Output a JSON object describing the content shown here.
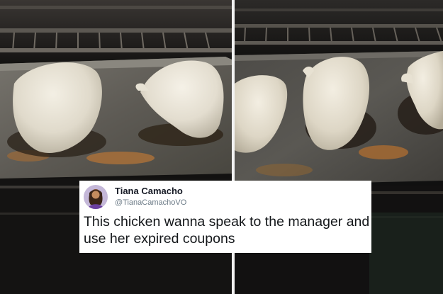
{
  "photos": {
    "left": {
      "subject": "Baked chicken breasts on a baking sheet inside an oven (first photo)"
    },
    "right": {
      "subject": "Baked chicken breasts on a baking sheet inside an oven (second photo)"
    }
  },
  "tweet": {
    "display_name": "Tiana Camacho",
    "handle": "@TianaCamachoVO",
    "text": "This chicken wanna speak to the manager and use her expired coupons",
    "avatar_icon": "profile-photo-icon"
  },
  "colors": {
    "oven_interior": "#171717",
    "baking_sheet": "#5f5d58",
    "chicken": "#e6e1d3",
    "juice_stain": "#b3783a",
    "card_background": "#ffffff"
  }
}
